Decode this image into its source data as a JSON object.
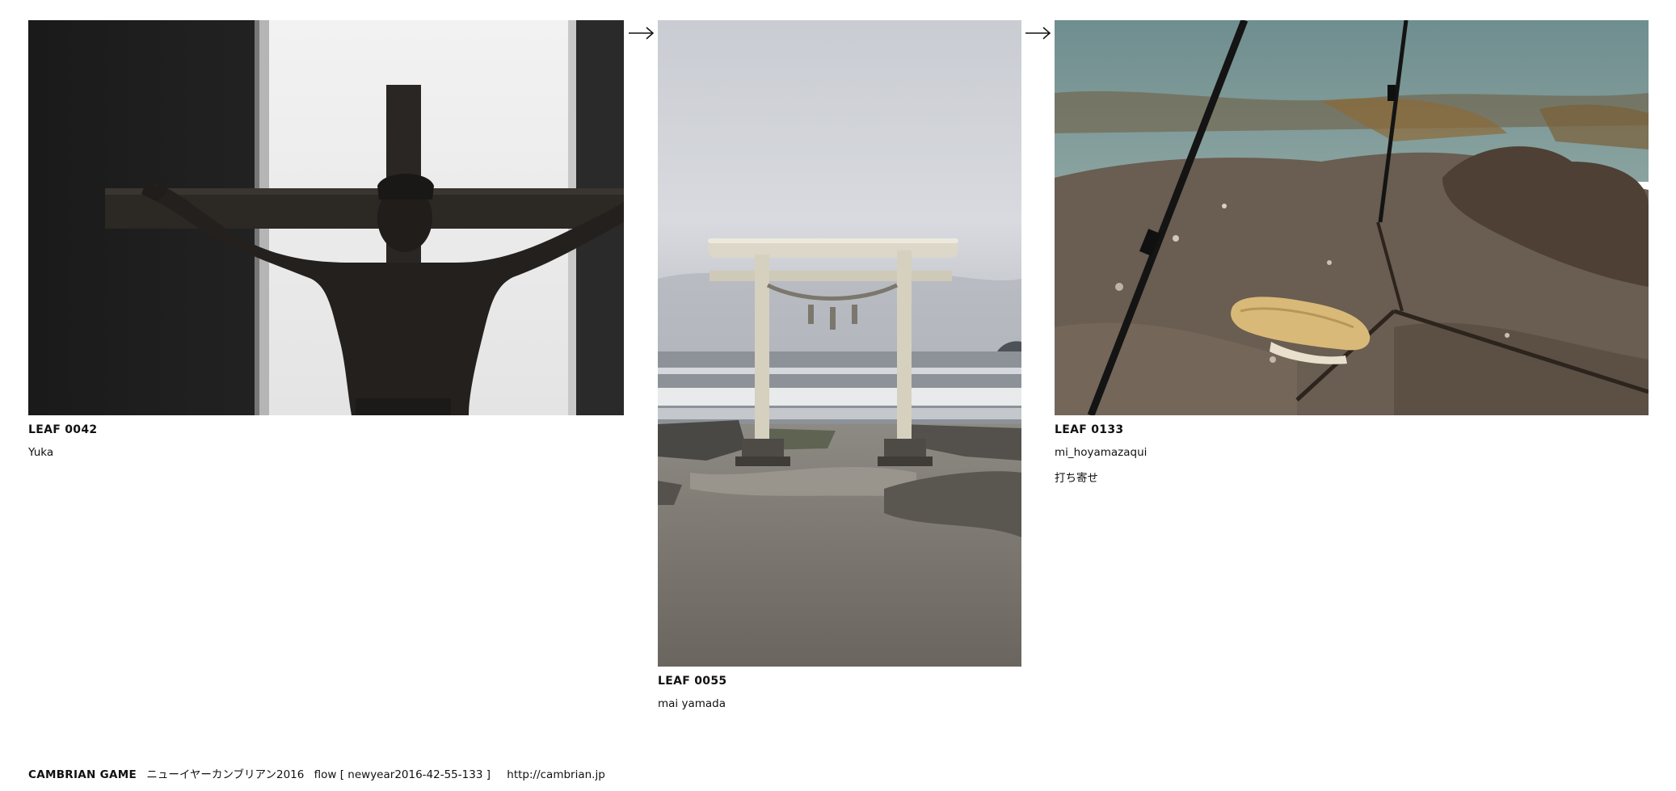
{
  "leaves": [
    {
      "id": "LEAF 0042",
      "author": "Yuka",
      "title": ""
    },
    {
      "id": "LEAF 0055",
      "author": "mai yamada",
      "title": ""
    },
    {
      "id": "LEAF 0133",
      "author": "mi_hoyamazaqui",
      "title": "打ち寄せ"
    }
  ],
  "flow_arrow_icon": "arrow-right-icon",
  "footer": {
    "brand": "CAMBRIAN GAME",
    "event": "ニューイヤーカンブリアン2016",
    "flow": "flow [ newyear2016-42-55-133 ]",
    "url": "http://cambrian.jp"
  }
}
